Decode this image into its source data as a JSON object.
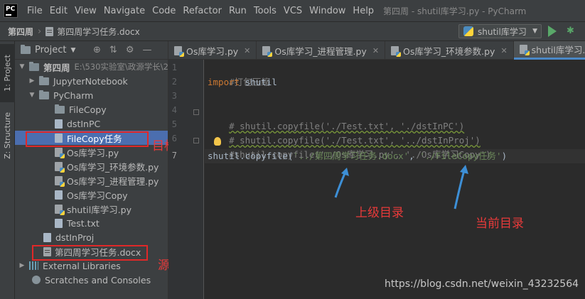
{
  "window": {
    "title": "第四周 - shutil库学习.py - PyCharm",
    "logo": "PC"
  },
  "menu": [
    "File",
    "Edit",
    "View",
    "Navigate",
    "Code",
    "Refactor",
    "Run",
    "Tools",
    "VCS",
    "Window",
    "Help"
  ],
  "breadcrumb": {
    "project": "第四周",
    "file": "第四周学习任务.docx"
  },
  "run_config": {
    "label": "shutil库学习"
  },
  "tool_windows": {
    "project": "1: Project",
    "structure": "Z: Structure"
  },
  "project_panel": {
    "title": "Project",
    "root_name": "第四周",
    "root_path": "E:\\530实验室\\政源学长\\2",
    "items": [
      {
        "label": "JupyterNotebook"
      },
      {
        "label": "PyCharm"
      },
      {
        "label": "FileCopy"
      },
      {
        "label": "dstInPC"
      },
      {
        "label": "FileCopy任务"
      },
      {
        "label": "Os库学习.py"
      },
      {
        "label": "Os库学习_环境参数.py"
      },
      {
        "label": "Os库学习_进程管理.py"
      },
      {
        "label": "Os库学习Copy"
      },
      {
        "label": "shutil库学习.py"
      },
      {
        "label": "Test.txt"
      },
      {
        "label": "dstInProj"
      },
      {
        "label": "第四周学习任务.docx"
      },
      {
        "label": "External Libraries"
      },
      {
        "label": "Scratches and Consoles"
      }
    ]
  },
  "tabs": [
    {
      "label": "Os库学习.py"
    },
    {
      "label": "Os库学习_进程管理.py"
    },
    {
      "label": "Os库学习_环境参数.py"
    },
    {
      "label": "shutil库学习.py"
    }
  ],
  "editor": {
    "line_numbers": [
      "1",
      "2",
      "3",
      "4",
      "5",
      "6",
      "7"
    ],
    "lines": {
      "l1_comment": "#打包压缩",
      "l2_import": "import",
      "l2_module": " shutil",
      "l4_comment": "# shutil.copyfile('./Test.txt', './dstInPC')",
      "l5_comment": "# shutil.copyfile('./Test.txt', '../dstInProj')",
      "l6_comment": "#shutil.copyfile('./Os库学习.py', './Os库学习Copy')",
      "l7_call": "shutil.copyfile(",
      "l7_arg1": "'../第四周学习任务.docx'",
      "l7_comma": ", ",
      "l7_arg2": "'./FileCopy任务'",
      "l7_close": ")"
    }
  },
  "annotations": {
    "target_file": "目标文件",
    "source_file": "源文件",
    "parent_dir": "上级目录",
    "current_dir": "当前目录"
  },
  "watermark": "https://blog.csdn.net/weixin_43232564",
  "colors": {
    "annotation_red": "#e83a3a",
    "arrow_blue": "#3d8fd6",
    "selection": "#4b6eaf"
  }
}
